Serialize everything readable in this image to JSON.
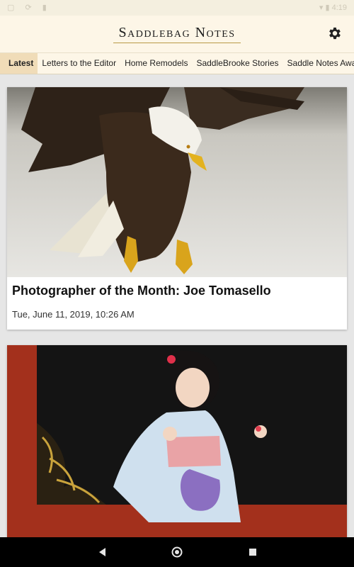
{
  "status_bar": {
    "left_icons": [
      "notification-icon",
      "sync-icon",
      "sd-card-icon"
    ],
    "right_icons": [
      "wifi-icon",
      "battery-icon"
    ],
    "time": "4:19"
  },
  "app": {
    "title": "Saddlebag Notes",
    "settings_icon": "gear-icon"
  },
  "tabs": [
    {
      "label": "Latest",
      "active": true
    },
    {
      "label": "Letters to the Editor"
    },
    {
      "label": "Home Remodels"
    },
    {
      "label": "SaddleBrooke Stories"
    },
    {
      "label": "Saddle Notes Awards"
    }
  ],
  "articles": [
    {
      "title": "Photographer of the Month: Joe Tomasello",
      "date": "Tue, June 11, 2019, 10:26 AM",
      "image": "bald-eagle-photo"
    },
    {
      "title": "",
      "date": "",
      "image": "woman-in-kimono-photo"
    }
  ],
  "nav": [
    "back-icon",
    "home-icon",
    "recents-icon"
  ]
}
